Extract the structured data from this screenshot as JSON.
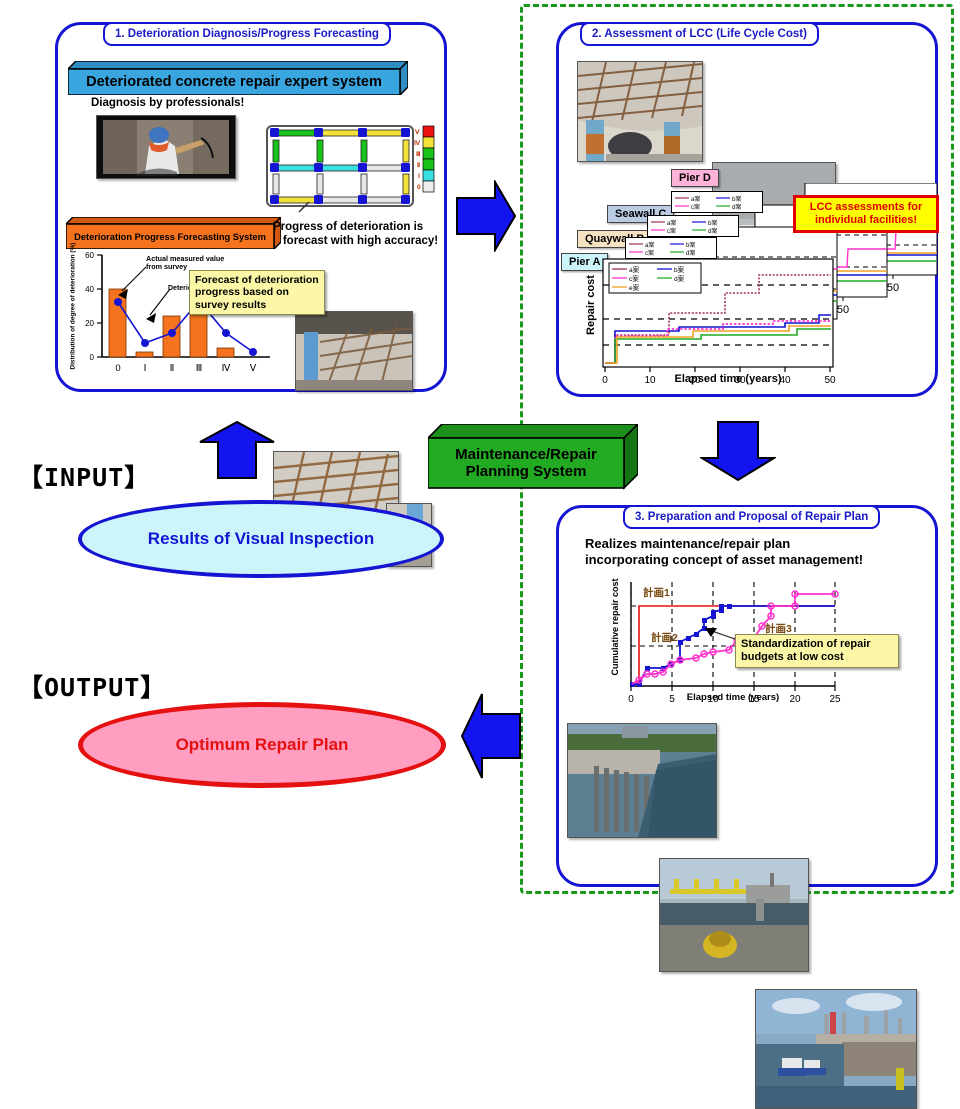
{
  "panels": {
    "p1": {
      "title": "1. Deterioration Diagnosis/Progress Forecasting",
      "banner": "Deteriorated concrete repair expert system",
      "subhead": "Diagnosis by professionals!",
      "orange_banner": "Deterioration Progress Forecasting System",
      "accuracy_text_l1": "Progress of deterioration is",
      "accuracy_text_l2": "forecast with high accuracy!",
      "callout": "Forecast of deterioration progress based on survey results",
      "annot_measured": "Actual measured value from survey",
      "annot_system": "Deterioration Progress Forecasting System",
      "legend_grades": [
        "Ⅴ",
        "Ⅳ",
        "Ⅲ",
        "Ⅱ",
        "Ⅰ",
        "0"
      ]
    },
    "p2": {
      "title": "2. Assessment of LCC (Life Cycle Cost)",
      "facility_tags": [
        "Pier D",
        "Seawall C",
        "Quaywall B",
        "Pier A"
      ],
      "redcallout_l1": "LCC assessments for",
      "redcallout_l2": "individual facilities!",
      "legend": [
        "a案",
        "b案",
        "c案",
        "d案",
        "e案"
      ],
      "mini_tick": "50"
    },
    "p3": {
      "title": "3. Preparation and Proposal of Repair Plan",
      "head_l1": "Realizes maintenance/repair plan",
      "head_l2": "incorporating concept of asset management!",
      "plan_labels": [
        "計画1",
        "計画2",
        "計画3"
      ],
      "callout_l1": "Standardization of repair",
      "callout_l2": "budgets at low cost"
    }
  },
  "center": {
    "system_l1": "Maintenance/Repair",
    "system_l2": "Planning System"
  },
  "io": {
    "input_label": "【INPUT】",
    "input_value": "Results of Visual Inspection",
    "output_label": "【OUTPUT】",
    "output_value": "Optimum Repair Plan"
  },
  "colors": {
    "panel_border": "#1414d2",
    "group_dashed": "#1a9a1a",
    "arrow_blue": "#1414f0",
    "banner_blue": "#3aa6e0",
    "banner_orange": "#f4731c",
    "system_green": "#22aa22",
    "input_fill": "#ccf5fb",
    "input_text": "#1414d2",
    "output_fill": "#ff9ec0",
    "output_text": "#e51010",
    "callout_yellow": "#fbf7a6",
    "alert_red": "#e00000"
  },
  "chart_data": [
    {
      "type": "bar",
      "id": "deterioration-distribution",
      "title": "",
      "xlabel": "",
      "ylabel": "Distribution of degree of deterioration (%)",
      "categories": [
        "0",
        "Ⅰ",
        "Ⅱ",
        "Ⅲ",
        "Ⅳ",
        "Ⅴ"
      ],
      "ylim": [
        0,
        60
      ],
      "yticks": [
        0,
        20,
        40,
        60
      ],
      "grid": false,
      "series": [
        {
          "name": "Actual measured value from survey",
          "kind": "bar",
          "color": "#f4731c",
          "values": [
            40,
            3,
            24,
            27,
            5,
            0
          ]
        },
        {
          "name": "Deterioration Progress Forecasting System",
          "kind": "line",
          "color": "#1414d2",
          "values": [
            32,
            8,
            14,
            33,
            14,
            3
          ]
        }
      ]
    },
    {
      "type": "line",
      "id": "lcc-pier-a",
      "title": "",
      "xlabel": "Elapsed time (years)",
      "ylabel": "Repair cost",
      "xlim": [
        0,
        52
      ],
      "xticks": [
        0,
        10,
        20,
        30,
        40,
        50
      ],
      "grid": true,
      "legend_position": "top-left",
      "series": [
        {
          "name": "a案",
          "color": "#a03050",
          "points": [
            [
              0,
              2
            ],
            [
              3,
              26
            ],
            [
              15,
              26
            ],
            [
              16,
              48
            ],
            [
              27,
              48
            ],
            [
              28,
              66
            ],
            [
              39,
              66
            ],
            [
              40,
              86
            ],
            [
              50,
              86
            ]
          ]
        },
        {
          "name": "b案",
          "color": "#1414d2",
          "points": [
            [
              0,
              2
            ],
            [
              3,
              30
            ],
            [
              17,
              30
            ],
            [
              18,
              38
            ],
            [
              44,
              38
            ],
            [
              45,
              44
            ],
            [
              49,
              44
            ],
            [
              50,
              52
            ]
          ]
        },
        {
          "name": "c案",
          "color": "#ff33cc",
          "points": [
            [
              0,
              2
            ],
            [
              3,
              26
            ],
            [
              14,
              26
            ],
            [
              15,
              33
            ],
            [
              27,
              33
            ],
            [
              28,
              40
            ],
            [
              39,
              40
            ],
            [
              40,
              43
            ],
            [
              50,
              43
            ]
          ]
        },
        {
          "name": "d案",
          "color": "#22aa22",
          "points": [
            [
              0,
              2
            ],
            [
              3,
              24
            ],
            [
              23,
              24
            ],
            [
              24,
              30
            ],
            [
              42,
              30
            ],
            [
              43,
              38
            ],
            [
              50,
              38
            ]
          ]
        },
        {
          "name": "e案",
          "color": "#f0a020",
          "points": [
            [
              0,
              2
            ],
            [
              4,
              27
            ],
            [
              20,
              27
            ],
            [
              21,
              33
            ],
            [
              40,
              33
            ],
            [
              41,
              40
            ],
            [
              50,
              40
            ]
          ]
        }
      ]
    },
    {
      "type": "line",
      "id": "cumulative-repair-cost",
      "title": "",
      "xlabel": "Elapsed time (years)",
      "ylabel": "Cumulative repair cost",
      "xlim": [
        0,
        26
      ],
      "xticks": [
        0,
        5,
        10,
        15,
        20,
        25
      ],
      "grid": true,
      "series": [
        {
          "name": "計画1",
          "color": "#e51010",
          "points": [
            [
              0,
              2
            ],
            [
              1,
              2
            ],
            [
              1,
              78
            ],
            [
              25,
              78
            ]
          ]
        },
        {
          "name": "計画2",
          "color": "#1414d2",
          "points": [
            [
              0,
              2
            ],
            [
              1,
              2
            ],
            [
              2,
              16
            ],
            [
              4,
              16
            ],
            [
              5,
              20
            ],
            [
              6,
              22
            ],
            [
              6,
              36
            ],
            [
              7,
              40
            ],
            [
              8,
              44
            ],
            [
              9,
              48
            ],
            [
              9,
              56
            ],
            [
              10,
              60
            ],
            [
              10,
              64
            ],
            [
              11,
              66
            ],
            [
              11,
              72
            ],
            [
              12,
              78
            ],
            [
              25,
              78
            ]
          ]
        },
        {
          "name": "計画3",
          "color": "#ff33cc",
          "points": [
            [
              0,
              2
            ],
            [
              2,
              6
            ],
            [
              3,
              12
            ],
            [
              4,
              12
            ],
            [
              5,
              14
            ],
            [
              6,
              20
            ],
            [
              7,
              24
            ],
            [
              9,
              26
            ],
            [
              10,
              30
            ],
            [
              11,
              32
            ],
            [
              13,
              34
            ],
            [
              14,
              42
            ],
            [
              16,
              44
            ],
            [
              17,
              52
            ],
            [
              18,
              60
            ],
            [
              18,
              78
            ],
            [
              22,
              78
            ],
            [
              22,
              88
            ],
            [
              25,
              88
            ]
          ]
        }
      ]
    }
  ]
}
